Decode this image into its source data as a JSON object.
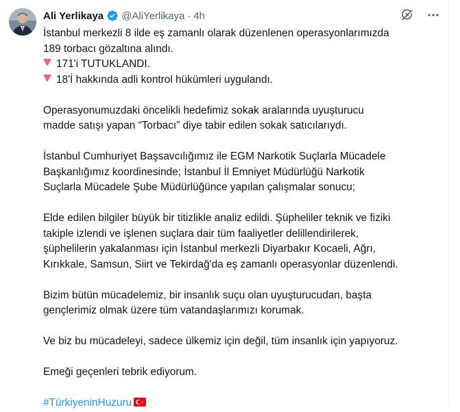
{
  "author": {
    "display_name": "Ali Yerlikaya",
    "handle": "@AliYerlikaya",
    "separator": "·",
    "time": "4h",
    "verified_icon": "verified-badge-icon",
    "avatar_icon": "profile-avatar"
  },
  "actions": {
    "grok_icon": "grok-icon",
    "more_icon": "more-options-icon"
  },
  "tweet": {
    "line1": "İstanbul merkezli 8 ilde eş zamanlı olarak düzenlenen operasyonlarımızda",
    "line2": "189 torbacı gözaltına alındı.",
    "bullet1": "171'i TUTUKLANDI.",
    "bullet2": "18'İ hakkında adli kontrol hükümleri uygulandı.",
    "para2_l1": "Operasyonumuzdaki öncelikli hedefimiz sokak aralarında uyuşturucu",
    "para2_l2": "madde satışı yapan “Torbacı” diye tabir edilen sokak satıcılarıydı.",
    "para3_l1": "İstanbul Cumhuriyet Başsavcılığımız ile EGM Narkotik Suçlarla Mücadele",
    "para3_l2": "Başkanlığımız koordinesinde; İstanbul İl Emniyet Müdürlüğü Narkotik",
    "para3_l3": "Suçlarla Mücadele Şube Müdürlüğünce yapılan çalışmalar sonucu;",
    "para4_l1": "Elde edilen bilgiler büyük bir titizlikle analiz edildi. Şüpheliler teknik ve fiziki",
    "para4_l2": "takiple izlendi ve işlenen suçlara dair tüm faaliyetler delillendirilerek,",
    "para4_l3": "şüphelilerin yakalanması için İstanbul merkezli Diyarbakır Kocaeli, Ağrı,",
    "para4_l4": "Kırıkkale, Samsun, Siirt ve Tekirdağ'da eş zamanlı operasyonlar düzenlendi.",
    "para5_l1": "Bizim bütün mücadelemiz, bir insanlık suçu olan uyuşturucudan, başta",
    "para5_l2": "gençlerimiz olmak üzere tüm vatandaşlarımızı korumak.",
    "para6": "Ve biz bu mücadeleyi, sadece ülkemiz için değil, tüm insanlık için yapıyoruz.",
    "para7": "Emeği geçenleri tebrik ediyorum.",
    "hashtag": "#TürkiyeninHuzuru",
    "flag_icon": "turkey-flag-icon",
    "bullet_icon": "red-triangle-down-icon"
  },
  "colors": {
    "link": "#1d9bf0",
    "muted": "#536471",
    "text": "#0f1419",
    "verified": "#1d9bf0",
    "bullet": "#f0607a",
    "flag": "#e30a17"
  }
}
